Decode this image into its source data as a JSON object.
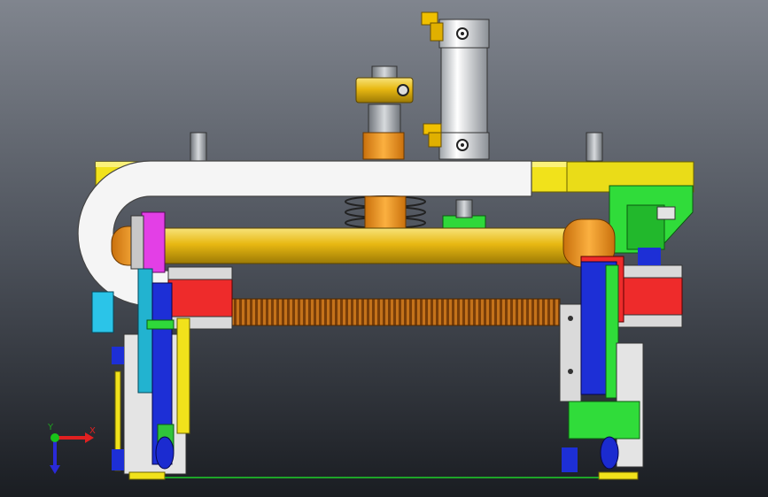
{
  "viewport": {
    "background_top": "#7b8089",
    "background_mid": "#4a4f58",
    "background_bottom": "#1b1e23"
  },
  "colors": {
    "yellow": "#f2e31a",
    "yellow_dark": "#b8a80e",
    "gold": "#e6b800",
    "orange": "#f29a1c",
    "red": "#ee2b2b",
    "magenta": "#e33fe6",
    "green": "#2edc3a",
    "blue": "#1d2fd6",
    "cyan": "#2bc4e8",
    "white_part": "#f4f4f4",
    "silver": "#c9cdd2"
  },
  "triad": {
    "x_label": "X",
    "y_label": "Y",
    "x_color": "#e02020",
    "y_color": "#2a2ad8",
    "origin_color": "#19c319"
  }
}
